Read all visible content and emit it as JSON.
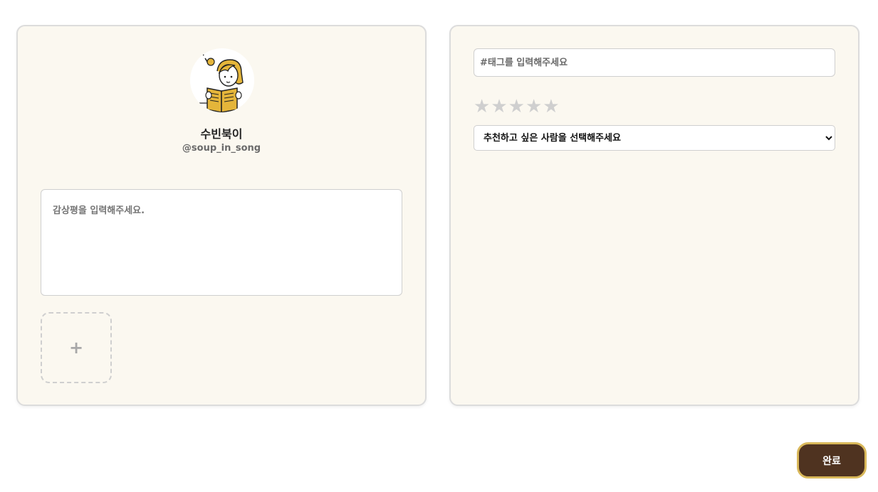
{
  "profile": {
    "name": "수빈북이",
    "handle": "@soup_in_song",
    "avatar_icon": "girl-reading-book-icon"
  },
  "review": {
    "placeholder": "감상평을 입력해주세요.",
    "value": ""
  },
  "photo_upload": {
    "label": "+"
  },
  "tags": {
    "placeholder": "#태그를 입력해주세요",
    "value": ""
  },
  "rating": {
    "max": 5,
    "value": 0,
    "stars": [
      "★",
      "★",
      "★",
      "★",
      "★"
    ]
  },
  "recommend": {
    "selected": "추천하고 싶은 사람을 선택해주세요"
  },
  "actions": {
    "done_label": "완료"
  },
  "colors": {
    "card_bg": "#fbf8f0",
    "button_bg": "#4f3320",
    "button_border": "#d9b85a",
    "star_empty": "#cfcfcf"
  }
}
